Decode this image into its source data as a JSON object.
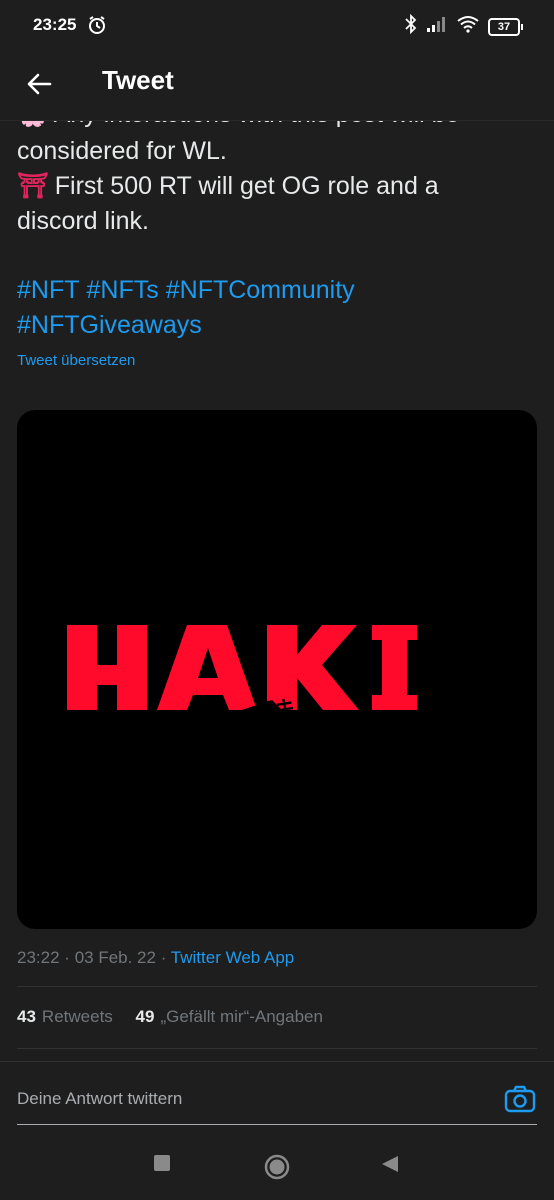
{
  "status_bar": {
    "time": "23:25",
    "battery": "37"
  },
  "header": {
    "title": "Tweet"
  },
  "tweet": {
    "partial_line": "🌸 Any interactions with this post will be",
    "lines": [
      "considered for WL.",
      "First 500 RT will get OG role and a",
      "discord link."
    ],
    "torii_glyph": "⛩",
    "hashtags": [
      "#NFT",
      "#NFTs",
      "#NFTCommunity",
      "#NFTGiveaways"
    ],
    "translate_label": "Tweet übersetzen",
    "image": {
      "logo_text": "HAKI",
      "logo_subtext": "ハキ",
      "logo_color": "#ff0a2a",
      "background": "#000000"
    },
    "time": "23:22",
    "date": "03 Feb. 22",
    "separator": "·",
    "source_app": "Twitter Web App",
    "retweets_count": "43",
    "retweets_label": "Retweets",
    "likes_count": "49",
    "likes_label": "„Gefällt mir“-Angaben"
  },
  "reply": {
    "placeholder": "Deine Antwort twittern"
  },
  "colors": {
    "accent": "#1d9bf0",
    "background": "#1e1e1e",
    "text": "#e7e9ea",
    "muted": "#71767b"
  }
}
